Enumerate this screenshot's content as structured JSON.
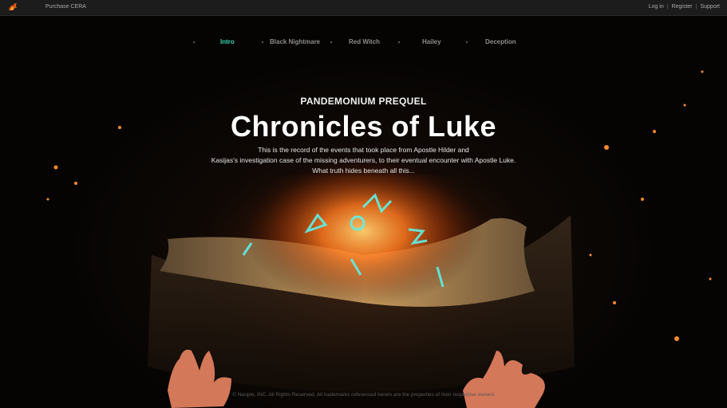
{
  "topbar": {
    "logo_icon": "flame-logo-icon",
    "purchase_label": "Purchase CERA",
    "login_label": "Log in",
    "register_label": "Register",
    "support_label": "Support",
    "separator": "|"
  },
  "nav": {
    "tabs": [
      {
        "label": "Intro",
        "active": true
      },
      {
        "label": "Black Nightmare",
        "active": false
      },
      {
        "label": "Red Witch",
        "active": false
      },
      {
        "label": "Hailey",
        "active": false
      },
      {
        "label": "Deception",
        "active": false
      }
    ]
  },
  "hero": {
    "pre_title": "PANDEMONIUM PREQUEL",
    "title": "Chronicles of Luke",
    "description": [
      "This is the record of the events that took place from Apostle Hilder and",
      "Kasijas's investigation case of the missing adventurers, to their eventual encounter with Apostle Luke.",
      "What truth hides beneath all this..."
    ]
  },
  "footer": {
    "copyright": "© Neople, INC. All Rights Reserved. All trademarks referenced herein are the properties of their respective owners"
  },
  "colors": {
    "active_tab": "#38d3b5",
    "inactive_tab": "#8c8c8c",
    "fire": "#ff8a28",
    "rune": "#5ff0e6"
  }
}
